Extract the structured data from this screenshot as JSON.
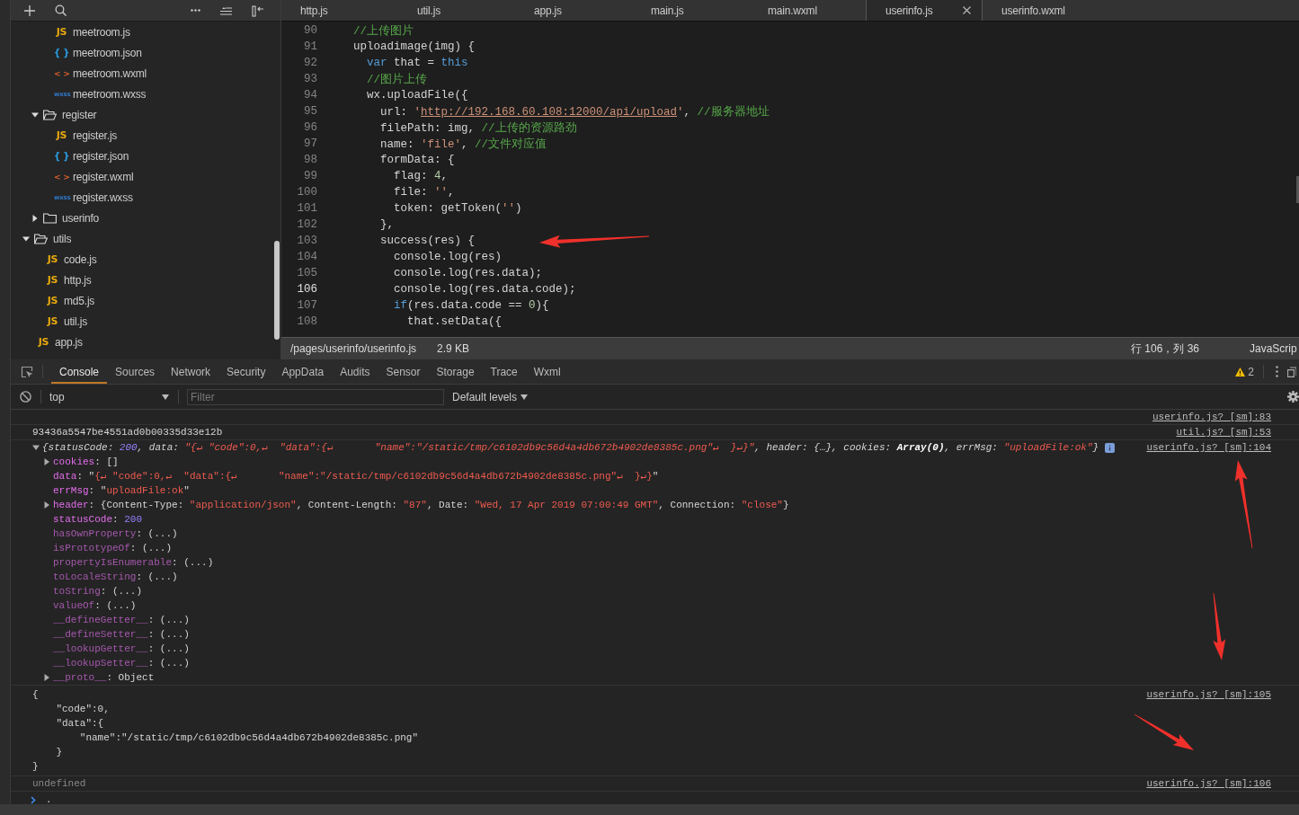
{
  "sidebar": {
    "tree": [
      {
        "children": [
          {
            "children": [
              {
                "label": "meetroom.js",
                "kind": "js",
                "icon": "JS"
              },
              {
                "label": "meetroom.json",
                "kind": "json",
                "icon": "{ }"
              },
              {
                "label": "meetroom.wxml",
                "kind": "wxml",
                "icon": "< >"
              },
              {
                "label": "meetroom.wxss",
                "kind": "wxss",
                "icon": "wxss"
              }
            ]
          },
          {
            "label": "register",
            "kind": "folder",
            "expanded": true,
            "children": [
              {
                "label": "register.js",
                "kind": "js",
                "icon": "JS"
              },
              {
                "label": "register.json",
                "kind": "json",
                "icon": "{ }"
              },
              {
                "label": "register.wxml",
                "kind": "wxml",
                "icon": "< >"
              },
              {
                "label": "register.wxss",
                "kind": "wxss",
                "icon": "wxss"
              }
            ]
          },
          {
            "label": "userinfo",
            "kind": "folder",
            "expanded": false
          }
        ]
      },
      {
        "label": "utils",
        "kind": "folder",
        "expanded": true,
        "children": [
          {
            "label": "code.js",
            "kind": "js",
            "icon": "JS"
          },
          {
            "label": "http.js",
            "kind": "js",
            "icon": "JS"
          },
          {
            "label": "md5.js",
            "kind": "js",
            "icon": "JS"
          },
          {
            "label": "util.js",
            "kind": "js",
            "icon": "JS"
          }
        ]
      },
      {
        "label": "app.js",
        "kind": "js",
        "icon": "JS"
      }
    ]
  },
  "editor": {
    "tabs": [
      {
        "label": "http.js",
        "selected": false
      },
      {
        "label": "util.js",
        "selected": false
      },
      {
        "label": "app.js",
        "selected": false
      },
      {
        "label": "main.js",
        "selected": false
      },
      {
        "label": "main.wxml",
        "selected": false
      },
      {
        "label": "userinfo.js",
        "selected": true
      },
      {
        "label": "userinfo.wxml",
        "selected": false
      }
    ],
    "lines": [
      {
        "number": "90",
        "current": false,
        "tokens": [
          {
            "kind": "comment",
            "text": "//上传图片"
          }
        ]
      },
      {
        "number": "91",
        "current": false,
        "tokens": [
          {
            "kind": "plain",
            "text": "uploadimage(img) {"
          }
        ]
      },
      {
        "number": "92",
        "current": false,
        "tokens": [
          {
            "kind": "keyword",
            "text": "  var"
          },
          {
            "kind": "plain",
            "text": " that = "
          },
          {
            "kind": "keyword",
            "text": "this"
          }
        ]
      },
      {
        "number": "93",
        "current": false,
        "tokens": [
          {
            "kind": "comment",
            "text": "  //图片上传"
          }
        ]
      },
      {
        "number": "94",
        "current": false,
        "tokens": [
          {
            "kind": "plain",
            "text": "  wx.uploadFile({"
          }
        ]
      },
      {
        "number": "95",
        "current": false,
        "tokens": [
          {
            "kind": "plain",
            "text": "    url: "
          },
          {
            "kind": "string",
            "text": "'"
          },
          {
            "kind": "link",
            "text": "http://192.168.60.108:12000/api/upload"
          },
          {
            "kind": "string",
            "text": "'"
          },
          {
            "kind": "plain",
            "text": ", "
          },
          {
            "kind": "comment",
            "text": "//服务器地址"
          }
        ]
      },
      {
        "number": "96",
        "current": false,
        "tokens": [
          {
            "kind": "plain",
            "text": "    filePath: img, "
          },
          {
            "kind": "comment",
            "text": "//上传的资源路劲"
          }
        ]
      },
      {
        "number": "97",
        "current": false,
        "tokens": [
          {
            "kind": "plain",
            "text": "    name: "
          },
          {
            "kind": "string",
            "text": "'file'"
          },
          {
            "kind": "plain",
            "text": ", "
          },
          {
            "kind": "comment",
            "text": "//文件对应值"
          }
        ]
      },
      {
        "number": "98",
        "current": false,
        "tokens": [
          {
            "kind": "plain",
            "text": "    formData: {"
          }
        ]
      },
      {
        "number": "99",
        "current": false,
        "tokens": [
          {
            "kind": "plain",
            "text": "      flag: "
          },
          {
            "kind": "number",
            "text": "4"
          },
          {
            "kind": "plain",
            "text": ","
          }
        ]
      },
      {
        "number": "100",
        "current": false,
        "tokens": [
          {
            "kind": "plain",
            "text": "      file: "
          },
          {
            "kind": "string",
            "text": "''"
          },
          {
            "kind": "plain",
            "text": ","
          }
        ]
      },
      {
        "number": "101",
        "current": false,
        "tokens": [
          {
            "kind": "plain",
            "text": "      token: getToken("
          },
          {
            "kind": "string",
            "text": "''"
          },
          {
            "kind": "plain",
            "text": ")"
          }
        ]
      },
      {
        "number": "102",
        "current": false,
        "tokens": [
          {
            "kind": "plain",
            "text": "    },"
          }
        ]
      },
      {
        "number": "103",
        "current": false,
        "tokens": [
          {
            "kind": "plain",
            "text": "    success(res) {"
          }
        ]
      },
      {
        "number": "104",
        "current": false,
        "tokens": [
          {
            "kind": "plain",
            "text": "      console.log(res)"
          }
        ]
      },
      {
        "number": "105",
        "current": false,
        "tokens": [
          {
            "kind": "plain",
            "text": "      console.log(res.data);"
          }
        ]
      },
      {
        "number": "106",
        "current": true,
        "tokens": [
          {
            "kind": "plain",
            "text": "      console.log(res.data.code);"
          }
        ]
      },
      {
        "number": "107",
        "current": false,
        "tokens": [
          {
            "kind": "keyword",
            "text": "      if"
          },
          {
            "kind": "plain",
            "text": "(res.data.code == "
          },
          {
            "kind": "number",
            "text": "0"
          },
          {
            "kind": "plain",
            "text": "){"
          }
        ]
      },
      {
        "number": "108",
        "current": false,
        "tokens": [
          {
            "kind": "plain",
            "text": "        that.setData({"
          }
        ]
      }
    ],
    "status_bar": {
      "path": "/pages/userinfo/userinfo.js",
      "size": "2.9 KB",
      "position": "行 106，列 36",
      "language": "JavaScrip"
    }
  },
  "devtools": {
    "tabs": [
      {
        "label": "Console",
        "selected": true
      },
      {
        "label": "Sources",
        "selected": false
      },
      {
        "label": "Network",
        "selected": false
      },
      {
        "label": "Security",
        "selected": false
      },
      {
        "label": "AppData",
        "selected": false
      },
      {
        "label": "Audits",
        "selected": false
      },
      {
        "label": "Sensor",
        "selected": false
      },
      {
        "label": "Storage",
        "selected": false
      },
      {
        "label": "Trace",
        "selected": false
      },
      {
        "label": "Wxml",
        "selected": false
      }
    ],
    "warning_count": "2",
    "context": "top",
    "filter": {
      "placeholder": "Filter"
    },
    "levels": "Default levels",
    "entries": [
      {
        "kind": "text",
        "source": "userinfo.js? [sm]:83"
      },
      {
        "kind": "text",
        "text": "93436a5547be4551ad0b00335d33e12b",
        "source": "util.js? [sm]:53"
      },
      {
        "kind": "object",
        "expanded": true,
        "source": "userinfo.js? [sm]:104",
        "summary": [
          {
            "kind": "plain",
            "text": "{"
          },
          {
            "kind": "key",
            "text": "statusCode"
          },
          {
            "kind": "plain",
            "text": ": "
          },
          {
            "kind": "number",
            "text": "200"
          },
          {
            "kind": "plain",
            "text": ", "
          },
          {
            "kind": "key",
            "text": "data"
          },
          {
            "kind": "plain",
            "text": ": "
          },
          {
            "kind": "string",
            "text": "\"{↵ \"code\":0,↵  \"data\":{↵       \"name\":\"/static/tmp/c6102db9c56d4a4db672b4902de8385c.png\"↵  }↵}\""
          },
          {
            "kind": "plain",
            "text": ", "
          },
          {
            "kind": "key",
            "text": "header"
          },
          {
            "kind": "plain",
            "text": ": {…}, "
          },
          {
            "kind": "key",
            "text": "cookies"
          },
          {
            "kind": "plain",
            "text": ": "
          },
          {
            "kind": "bold",
            "text": "Array(0)"
          },
          {
            "kind": "plain",
            "text": ", "
          },
          {
            "kind": "key",
            "text": "errMsg"
          },
          {
            "kind": "plain",
            "text": ": "
          },
          {
            "kind": "string",
            "text": "\"uploadFile:ok\""
          },
          {
            "kind": "plain",
            "text": "}"
          }
        ],
        "properties": [
          {
            "name": "cookies",
            "inherited": false,
            "expandable": true,
            "value": [
              {
                "kind": "plain",
                "text": ": []"
              }
            ]
          },
          {
            "name": "data",
            "inherited": false,
            "expandable": false,
            "value": [
              {
                "kind": "plain",
                "text": ": \""
              },
              {
                "kind": "string",
                "text": "{↵ \"code\":0,↵  \"data\":{↵       \"name\":\"/static/tmp/c6102db9c56d4a4db672b4902de8385c.png\"↵  }↵}"
              },
              {
                "kind": "plain",
                "text": "\""
              }
            ]
          },
          {
            "name": "errMsg",
            "inherited": false,
            "expandable": false,
            "value": [
              {
                "kind": "plain",
                "text": ": \""
              },
              {
                "kind": "string",
                "text": "uploadFile:ok"
              },
              {
                "kind": "plain",
                "text": "\""
              }
            ]
          },
          {
            "name": "header",
            "inherited": false,
            "expandable": true,
            "value": [
              {
                "kind": "plain",
                "text": ": {Content-Type: "
              },
              {
                "kind": "string",
                "text": "\"application/json\""
              },
              {
                "kind": "plain",
                "text": ", Content-Length: "
              },
              {
                "kind": "string",
                "text": "\"87\""
              },
              {
                "kind": "plain",
                "text": ", Date: "
              },
              {
                "kind": "string",
                "text": "\"Wed, 17 Apr 2019 07:00:49 GMT\""
              },
              {
                "kind": "plain",
                "text": ", Connection: "
              },
              {
                "kind": "string",
                "text": "\"close\""
              },
              {
                "kind": "plain",
                "text": "}"
              }
            ]
          },
          {
            "name": "statusCode",
            "inherited": false,
            "expandable": false,
            "value": [
              {
                "kind": "plain",
                "text": ": "
              },
              {
                "kind": "number",
                "text": "200"
              }
            ]
          },
          {
            "name": "hasOwnProperty",
            "inherited": true,
            "expandable": false,
            "value": [
              {
                "kind": "plain",
                "text": ": (...)"
              }
            ]
          },
          {
            "name": "isPrototypeOf",
            "inherited": true,
            "expandable": false,
            "value": [
              {
                "kind": "plain",
                "text": ": (...)"
              }
            ]
          },
          {
            "name": "propertyIsEnumerable",
            "inherited": true,
            "expandable": false,
            "value": [
              {
                "kind": "plain",
                "text": ": (...)"
              }
            ]
          },
          {
            "name": "toLocaleString",
            "inherited": true,
            "expandable": false,
            "value": [
              {
                "kind": "plain",
                "text": ": (...)"
              }
            ]
          },
          {
            "name": "toString",
            "inherited": true,
            "expandable": false,
            "value": [
              {
                "kind": "plain",
                "text": ": (...)"
              }
            ]
          },
          {
            "name": "valueOf",
            "inherited": true,
            "expandable": false,
            "value": [
              {
                "kind": "plain",
                "text": ": (...)"
              }
            ]
          },
          {
            "name": "__defineGetter__",
            "inherited": true,
            "expandable": false,
            "value": [
              {
                "kind": "plain",
                "text": ": (...)"
              }
            ]
          },
          {
            "name": "__defineSetter__",
            "inherited": true,
            "expandable": false,
            "value": [
              {
                "kind": "plain",
                "text": ": (...)"
              }
            ]
          },
          {
            "name": "__lookupGetter__",
            "inherited": true,
            "expandable": false,
            "value": [
              {
                "kind": "plain",
                "text": ": (...)"
              }
            ]
          },
          {
            "name": "__lookupSetter__",
            "inherited": true,
            "expandable": false,
            "value": [
              {
                "kind": "plain",
                "text": ": (...)"
              }
            ]
          },
          {
            "name": "__proto__",
            "inherited": true,
            "expandable": true,
            "value": [
              {
                "kind": "plain",
                "text": ": Object"
              }
            ]
          }
        ]
      },
      {
        "kind": "block",
        "text": "{\n    \"code\":0,\n    \"data\":{\n        \"name\":\"/static/tmp/c6102db9c56d4a4db672b4902de8385c.png\"\n    }\n}",
        "source": "userinfo.js? [sm]:105"
      },
      {
        "kind": "result",
        "text": "undefined",
        "source": "userinfo.js? [sm]:106"
      }
    ],
    "prompt": "."
  }
}
